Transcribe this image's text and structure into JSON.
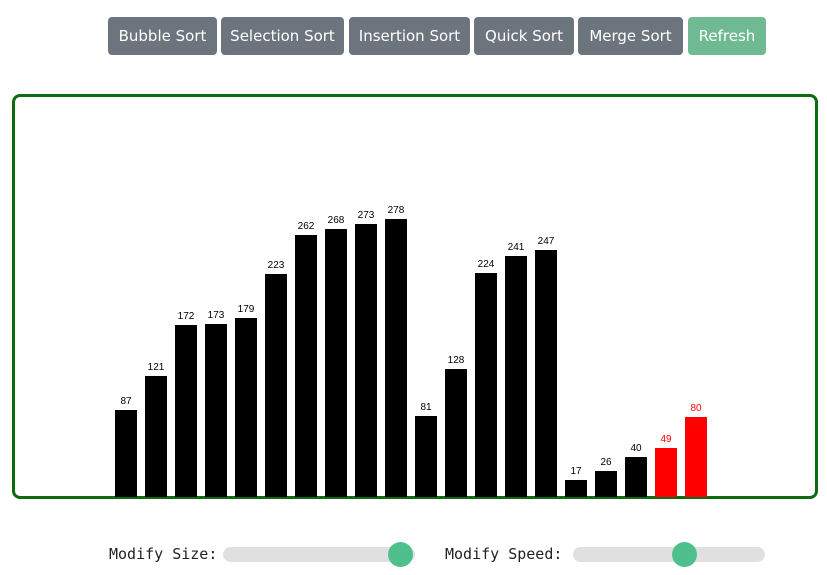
{
  "toolbar": {
    "buttons": [
      {
        "label": "Bubble Sort"
      },
      {
        "label": "Selection Sort"
      },
      {
        "label": "Insertion Sort"
      },
      {
        "label": "Quick Sort"
      },
      {
        "label": "Merge Sort"
      },
      {
        "label": "Refresh"
      }
    ]
  },
  "colors": {
    "button_gray": "#6c757d",
    "button_refresh": "#6fba93",
    "canvas_border": "#0f6b12",
    "bar_default": "#000000",
    "bar_active": "#ff0000",
    "slider_track": "#e0e0e0",
    "slider_thumb": "#4fc08d"
  },
  "chart_data": {
    "type": "bar",
    "values": [
      87,
      121,
      172,
      173,
      179,
      223,
      262,
      268,
      273,
      278,
      81,
      128,
      224,
      241,
      247,
      17,
      26,
      40,
      49,
      80
    ],
    "highlighted_indices": [
      18,
      19
    ],
    "ylim": [
      0,
      350
    ]
  },
  "controls": {
    "size_label": "Modify Size:",
    "size_value": 0.92,
    "speed_label": "Modify Speed:",
    "speed_value": 0.58
  }
}
